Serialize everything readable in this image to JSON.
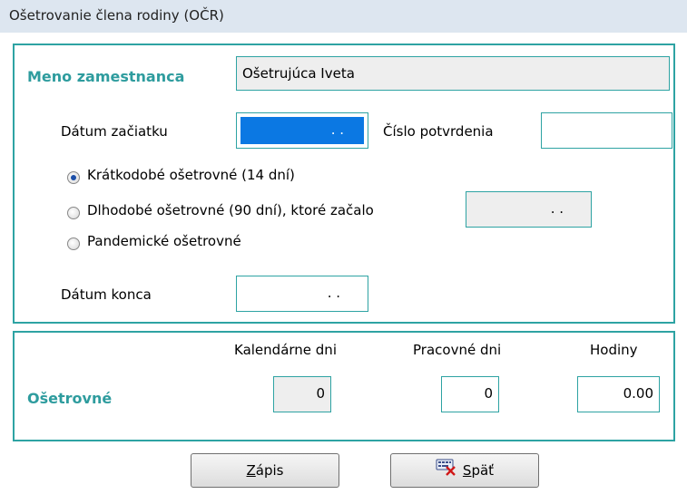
{
  "window": {
    "title": "Ošetrovanie člena rodiny (OČR)"
  },
  "employee": {
    "label": "Meno zamestnanca",
    "value": "Ošetrujúca Iveta"
  },
  "start_date": {
    "label": "Dátum začiatku",
    "value": ". ."
  },
  "confirmation_number": {
    "label": "Číslo potvrdenia",
    "value": ""
  },
  "options": [
    {
      "label": "Krátkodobé ošetrovné (14 dní)",
      "checked": true
    },
    {
      "label": "Dlhodobé ošetrovné (90 dní), ktoré začalo",
      "checked": false,
      "date_value": ". ."
    },
    {
      "label": "Pandemické ošetrovné",
      "checked": false
    }
  ],
  "end_date": {
    "label": "Dátum konca",
    "value": ". ."
  },
  "summary": {
    "row_label": "Ošetrovné",
    "columns": [
      "Kalendárne dni",
      "Pracovné dni",
      "Hodiny"
    ],
    "values": [
      "0",
      "0",
      "0.00"
    ]
  },
  "buttons": {
    "save_hotkey": "Z",
    "save_rest": "ápis",
    "back_hotkey": "S",
    "back_rest": "päť",
    "back_icon": "keyboard-cancel-icon"
  },
  "colors": {
    "accent": "#2e9c9e",
    "selection": "#0b78e3",
    "titlebar": "#dde6f0"
  }
}
